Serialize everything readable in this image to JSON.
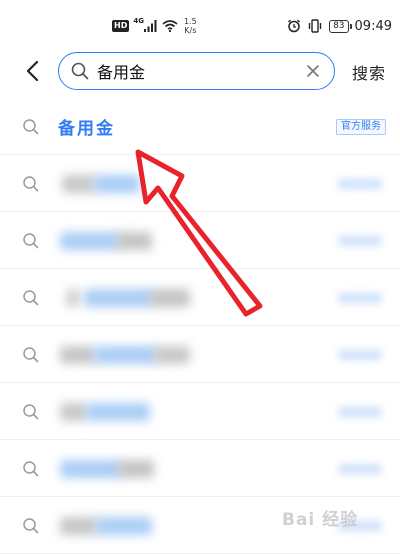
{
  "status_bar": {
    "network_badge": "HD",
    "network_type": "4G",
    "speed_value": "1.5",
    "speed_unit": "K/s",
    "battery": "83",
    "time": "09:49"
  },
  "search": {
    "value": "备用金",
    "submit_label": "搜索"
  },
  "results": {
    "first": {
      "label": "备用金",
      "tag": "官方服务"
    }
  },
  "watermark": "Bai 经验",
  "colors": {
    "accent": "#2f7df6",
    "annotation_arrow": "#e8232b"
  },
  "icons": {
    "back": "chevron-left-icon",
    "search": "search-icon",
    "clear": "close-icon",
    "wifi": "wifi-icon",
    "signal": "signal-icon",
    "alarm": "alarm-icon",
    "vibrate": "vibrate-icon",
    "battery": "battery-icon"
  }
}
